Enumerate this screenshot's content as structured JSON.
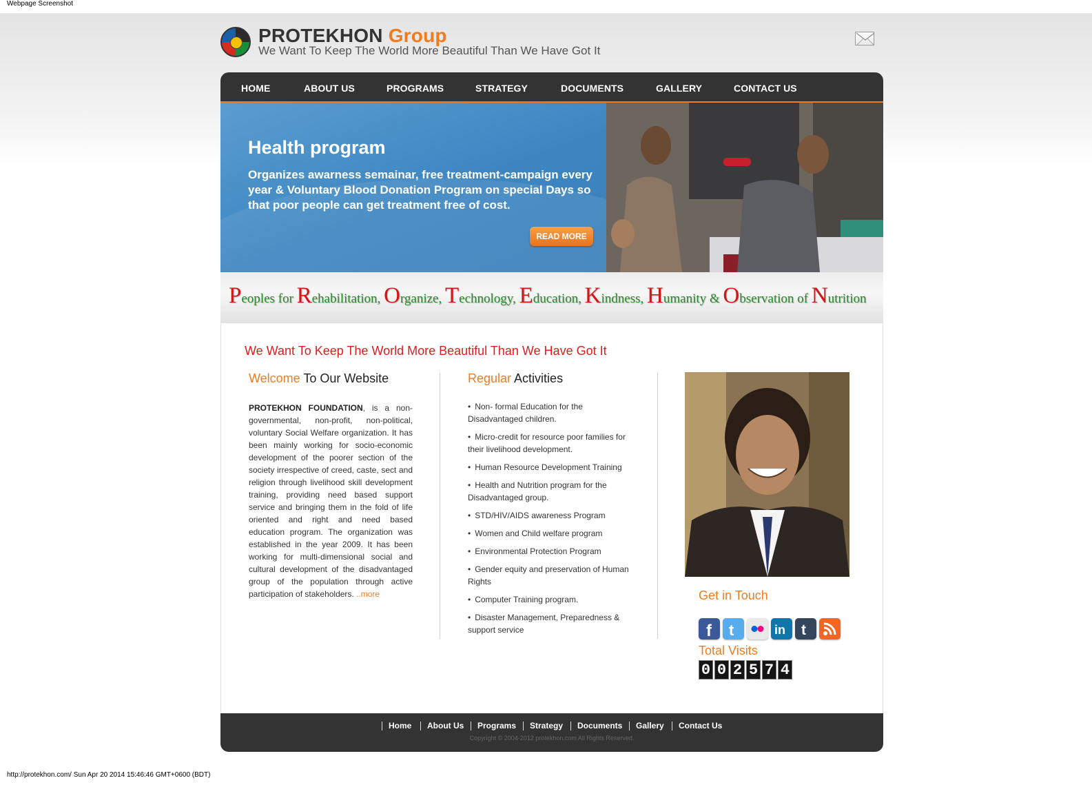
{
  "screenshot_caption": "Webpage Screenshot",
  "url_footer": "http://protekhon.com/ Sun Apr 20 2014 15:46:46 GMT+0600 (BDT)",
  "header": {
    "brand": "PROTEKHON",
    "brand_accent": "Group",
    "tagline": "We Want To Keep The World More Beautiful Than We Have Got It",
    "mail_icon": "envelope-icon"
  },
  "nav": {
    "items": [
      "HOME",
      "ABOUT US",
      "PROGRAMS",
      "STRATEGY",
      "DOCUMENTS",
      "GALLERY",
      "CONTACT US"
    ]
  },
  "hero": {
    "title": "Health program",
    "text": "Organizes awarness semainar, free treatment-campaign every year & Voluntary Blood Donation Program on special Days so that poor people can get treatment free of cost.",
    "button": "READ MORE"
  },
  "acronym": [
    {
      "cap": "P",
      "rest": "eoples for "
    },
    {
      "cap": "R",
      "rest": "ehabilitation, "
    },
    {
      "cap": "O",
      "rest": "rganize, "
    },
    {
      "cap": "T",
      "rest": "echnology, "
    },
    {
      "cap": "E",
      "rest": "ducation, "
    },
    {
      "cap": "K",
      "rest": "indness, "
    },
    {
      "cap": "H",
      "rest": "umanity & "
    },
    {
      "cap": "O",
      "rest": "bservation of "
    },
    {
      "cap": "N",
      "rest": "utrition"
    }
  ],
  "main": {
    "heading": "We Want To Keep The World More Beautiful Than We Have Got It",
    "welcome": {
      "title_accent": "Welcome",
      "title_rest": " To Our Website",
      "org_name": "PROTEKHON FOUNDATION",
      "body": ", is a non-governmental, non-profit, non-political, voluntary Social Welfare organization. It has been mainly working for socio-economic development of the poorer section of the society irrespective of creed, caste, sect and religion through livelihood skill development training, providing need based support service and bringing them in the fold of life oriented and right and need based education program. The organization was established in the year 2009. It has been working for multi-dimensional social and cultural development of the disadvantaged group of the population through active participation of stakeholders. ",
      "more": "..more"
    },
    "activities": {
      "title_accent": "Regular",
      "title_rest": " Activities",
      "items": [
        "Non- formal Education for the Disadvantaged children.",
        "Micro-credit for resource poor families for their livelihood development.",
        "Human Resource Development Training",
        "Health and Nutrition program for the Disadvantaged group.",
        "STD/HIV/AIDS awareness Program",
        "Women and Child welfare program",
        "Environmental Protection Program",
        "Gender equity and preservation of Human Rights",
        "Computer Training program.",
        "Disaster Management, Preparedness & support service"
      ]
    },
    "sidebar": {
      "get_in_touch": "Get in Touch",
      "social": [
        {
          "name": "facebook-icon",
          "color": "#3b5998"
        },
        {
          "name": "twitter-icon",
          "color": "#55acee"
        },
        {
          "name": "flickr-icon",
          "color": "#e9e9e9"
        },
        {
          "name": "linkedin-icon",
          "color": "#0e76a8"
        },
        {
          "name": "tumblr-icon",
          "color": "#35465c"
        },
        {
          "name": "rss-icon",
          "color": "#f26522"
        }
      ],
      "total_visits": "Total Visits",
      "visits_digits": [
        "0",
        "0",
        "2",
        "5",
        "7",
        "4"
      ]
    }
  },
  "footer": {
    "links": [
      "Home",
      "About Us",
      "Programs",
      "Strategy",
      "Documents",
      "Gallery",
      "Contact Us"
    ],
    "copyright": "Copyright © 2004-2012 protekhon.com All Rights Reserved."
  },
  "colors": {
    "accent": "#f07c1f",
    "nav_bg": "#333333",
    "hero_blue": "#3d86c2",
    "heading_red": "#e01d1d",
    "acronym_green": "#2b8a2b",
    "acronym_red": "#d01818"
  }
}
